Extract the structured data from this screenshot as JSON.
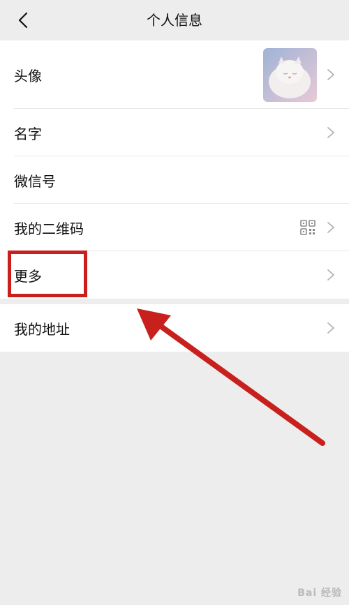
{
  "header": {
    "title": "个人信息",
    "back_icon": "chevron-left-icon"
  },
  "rows": [
    {
      "label": "头像",
      "accessory": "avatar-image",
      "chevron": true
    },
    {
      "label": "名字",
      "chevron": true
    },
    {
      "label": "微信号",
      "chevron": false
    },
    {
      "label": "我的二维码",
      "accessory": "qr-code-icon",
      "chevron": true
    },
    {
      "label": "更多",
      "chevron": true,
      "highlighted": true
    }
  ],
  "rows2": [
    {
      "label": "我的地址",
      "chevron": true
    }
  ],
  "annotation": {
    "color": "#c8201c",
    "target": "更多"
  },
  "watermark": {
    "text": "Bai 经验"
  },
  "colors": {
    "background": "#ededed",
    "card": "#ffffff",
    "annotation": "#c8201c"
  }
}
